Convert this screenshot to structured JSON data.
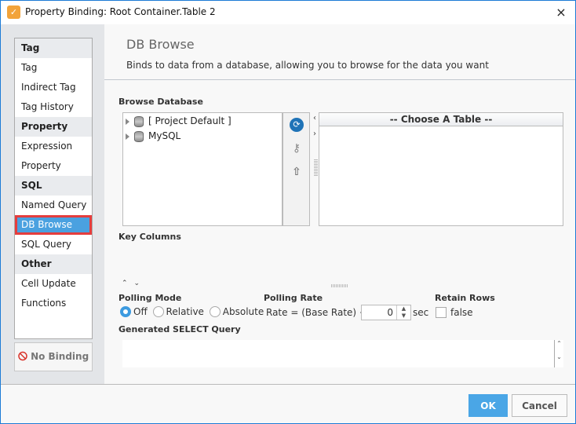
{
  "window": {
    "title": "Property Binding: Root Container.Table 2",
    "close_icon": "×"
  },
  "sidebar": {
    "groups": [
      {
        "header": "Tag",
        "items": [
          "Tag",
          "Indirect Tag",
          "Tag History"
        ]
      },
      {
        "header": "Property",
        "items": [
          "Expression",
          "Property"
        ]
      },
      {
        "header": "SQL",
        "items": [
          "Named Query",
          "DB Browse",
          "SQL Query"
        ]
      },
      {
        "header": "Other",
        "items": [
          "Cell Update",
          "Functions"
        ]
      }
    ],
    "selected": "DB Browse",
    "no_binding_label": "No Binding",
    "no_binding_icon": "⃠"
  },
  "main": {
    "title": "DB Browse",
    "description": "Binds to data from a database, allowing you to browse for the data you want",
    "browse_label": "Browse Database",
    "tree": [
      "[ Project Default ]",
      "MySQL"
    ],
    "table_header": "-- Choose A Table --",
    "key_columns_label": "Key Columns",
    "polling_mode_label": "Polling Mode",
    "polling_modes": [
      "Off",
      "Relative",
      "Absolute"
    ],
    "polling_mode_selected": "Off",
    "polling_rate_label": "Polling Rate",
    "rate_text": "Rate = (Base Rate) +/-",
    "rate_value": "0",
    "rate_unit": "sec",
    "retain_rows_label": "Retain Rows",
    "retain_rows_value": "false",
    "query_label": "Generated SELECT Query",
    "query_value": ""
  },
  "footer": {
    "ok_label": "OK",
    "cancel_label": "Cancel"
  },
  "colors": {
    "accent": "#4aa6e6",
    "selected_outline": "#e53d3d",
    "window_border": "#1c7bd6"
  }
}
